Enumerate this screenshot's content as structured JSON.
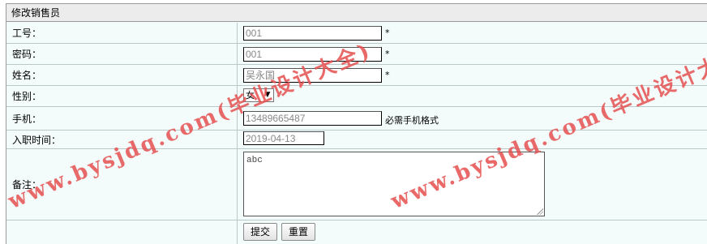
{
  "form": {
    "title": "修改销售员",
    "fields": [
      {
        "label": "工号：",
        "value": "001",
        "required": "*"
      },
      {
        "label": "密码：",
        "value": "001",
        "required": "*"
      },
      {
        "label": "姓名：",
        "value": "吴永国",
        "required": "*"
      },
      {
        "label": "性别：",
        "value": "女"
      },
      {
        "label": "手机：",
        "value": "13489665487",
        "note": "必需手机格式"
      },
      {
        "label": "入职时间：",
        "value": "2019-04-13"
      },
      {
        "label": "备注：",
        "value": "abc"
      }
    ],
    "submit_label": "提交",
    "reset_label": "重置"
  },
  "watermark": {
    "text": "www.bysjdq.com(毕业设计大全)",
    "color": "#e65050"
  }
}
